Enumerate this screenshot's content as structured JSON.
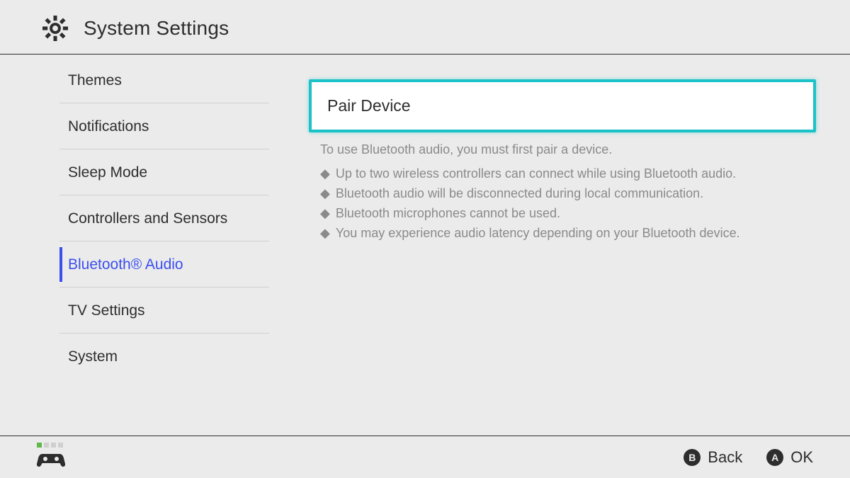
{
  "header": {
    "title": "System Settings"
  },
  "sidebar": {
    "items": [
      {
        "label": "Themes",
        "active": false
      },
      {
        "label": "Notifications",
        "active": false
      },
      {
        "label": "Sleep Mode",
        "active": false
      },
      {
        "label": "Controllers and Sensors",
        "active": false
      },
      {
        "label": "Bluetooth® Audio",
        "active": true
      },
      {
        "label": "TV Settings",
        "active": false
      },
      {
        "label": "System",
        "active": false
      }
    ]
  },
  "main": {
    "pair_button_label": "Pair Device",
    "intro": "To use Bluetooth audio, you must first pair a device.",
    "bullets": [
      "Up to two wireless controllers can connect while using Bluetooth audio.",
      "Bluetooth audio will be disconnected during local communication.",
      "Bluetooth microphones cannot be used.",
      "You may experience audio latency depending on your Bluetooth device."
    ]
  },
  "footer": {
    "buttons": {
      "b": {
        "letter": "B",
        "label": "Back"
      },
      "a": {
        "letter": "A",
        "label": "OK"
      }
    }
  }
}
